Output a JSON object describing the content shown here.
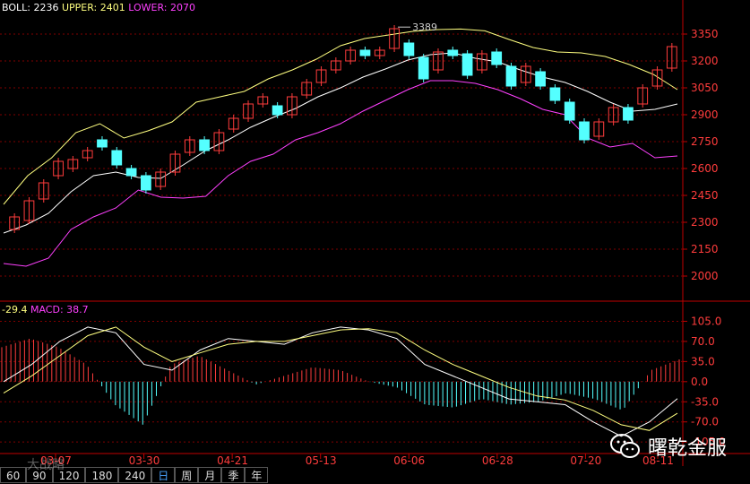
{
  "legend_top": {
    "boll_label": "BOLL:",
    "boll_value": "2236",
    "upper_label": "UPPER:",
    "upper_value": "2401",
    "lower_label": "LOWER:",
    "lower_value": "2070"
  },
  "legend_bottom": {
    "dif_value": "-29.4",
    "macd_label": "MACD:",
    "macd_value": "38.7"
  },
  "colors": {
    "up": "#ff3c3c",
    "down": "#54ffff",
    "mid": "#ffffff",
    "upper": "#ffff80",
    "lower": "#ff40ff",
    "grid": "#800000",
    "axis": "#c00000",
    "text": "#ff3c3c"
  },
  "periods": [
    "60",
    "90",
    "120",
    "180",
    "240",
    "日",
    "周",
    "月",
    "季",
    "年"
  ],
  "active_period": "日",
  "watermark_text": "曙乾金服",
  "faint_watermark": "大战略",
  "chart_data": [
    {
      "type": "candlestick",
      "title": "",
      "indicator": "BOLL",
      "y_ticks": [
        3350,
        3200,
        3050,
        2900,
        2750,
        2600,
        2450,
        2300,
        2150,
        2000
      ],
      "ylim": [
        1870,
        3450
      ],
      "x_ticks": [
        "03-07",
        "03-30",
        "04-21",
        "05-13",
        "06-06",
        "06-28",
        "07-20",
        "08-11"
      ],
      "annotation": {
        "label": "3389",
        "value": 3389
      },
      "series": [
        {
          "name": "BOLL",
          "values": [
            2240,
            2285,
            2350,
            2470,
            2560,
            2580,
            2550,
            2545,
            2620,
            2700,
            2760,
            2830,
            2885,
            2935,
            3000,
            3050,
            3110,
            3155,
            3205,
            3235,
            3245,
            3215,
            3195,
            3150,
            3110,
            3080,
            3030,
            2970,
            2920,
            2930,
            2960
          ]
        },
        {
          "name": "UPPER",
          "values": [
            2400,
            2560,
            2660,
            2800,
            2850,
            2770,
            2810,
            2860,
            2970,
            3000,
            3030,
            3100,
            3150,
            3210,
            3285,
            3325,
            3345,
            3365,
            3375,
            3378,
            3368,
            3320,
            3275,
            3250,
            3245,
            3225,
            3180,
            3125,
            3040
          ]
        },
        {
          "name": "LOWER",
          "values": [
            2070,
            2055,
            2100,
            2260,
            2330,
            2380,
            2480,
            2440,
            2435,
            2445,
            2560,
            2640,
            2680,
            2760,
            2800,
            2850,
            2920,
            2980,
            3040,
            3090,
            3090,
            3075,
            3040,
            2990,
            2930,
            2900,
            2770,
            2720,
            2740,
            2660,
            2670
          ]
        }
      ],
      "candles": [
        {
          "o": 2260,
          "c": 2330
        },
        {
          "o": 2310,
          "c": 2420
        },
        {
          "o": 2430,
          "c": 2520
        },
        {
          "o": 2560,
          "c": 2640
        },
        {
          "o": 2600,
          "c": 2650
        },
        {
          "o": 2660,
          "c": 2700
        },
        {
          "o": 2760,
          "c": 2720
        },
        {
          "o": 2700,
          "c": 2620
        },
        {
          "o": 2600,
          "c": 2560
        },
        {
          "o": 2560,
          "c": 2480
        },
        {
          "o": 2500,
          "c": 2580
        },
        {
          "o": 2580,
          "c": 2680
        },
        {
          "o": 2690,
          "c": 2760
        },
        {
          "o": 2760,
          "c": 2700
        },
        {
          "o": 2700,
          "c": 2800
        },
        {
          "o": 2820,
          "c": 2880
        },
        {
          "o": 2880,
          "c": 2960
        },
        {
          "o": 2960,
          "c": 3000
        },
        {
          "o": 2950,
          "c": 2900
        },
        {
          "o": 2900,
          "c": 3000
        },
        {
          "o": 3010,
          "c": 3080
        },
        {
          "o": 3080,
          "c": 3150
        },
        {
          "o": 3150,
          "c": 3200
        },
        {
          "o": 3200,
          "c": 3260
        },
        {
          "o": 3260,
          "c": 3230
        },
        {
          "o": 3230,
          "c": 3260
        },
        {
          "o": 3270,
          "c": 3380
        },
        {
          "o": 3300,
          "c": 3230
        },
        {
          "o": 3220,
          "c": 3100
        },
        {
          "o": 3150,
          "c": 3250
        },
        {
          "o": 3260,
          "c": 3230
        },
        {
          "o": 3240,
          "c": 3120
        },
        {
          "o": 3150,
          "c": 3240
        },
        {
          "o": 3250,
          "c": 3180
        },
        {
          "o": 3170,
          "c": 3060
        },
        {
          "o": 3080,
          "c": 3170
        },
        {
          "o": 3140,
          "c": 3060
        },
        {
          "o": 3050,
          "c": 2980
        },
        {
          "o": 2970,
          "c": 2870
        },
        {
          "o": 2860,
          "c": 2760
        },
        {
          "o": 2780,
          "c": 2860
        },
        {
          "o": 2860,
          "c": 2940
        },
        {
          "o": 2940,
          "c": 2870
        },
        {
          "o": 2960,
          "c": 3050
        },
        {
          "o": 3060,
          "c": 3150
        },
        {
          "o": 3160,
          "c": 3280
        }
      ]
    },
    {
      "type": "macd",
      "title": "",
      "y_ticks": [
        105.0,
        70.0,
        35.0,
        0.0,
        -35.0,
        -70.0,
        -105.0
      ],
      "ylim": [
        -125,
        140
      ],
      "series": [
        {
          "name": "DIF",
          "values": [
            0,
            30,
            70,
            95,
            85,
            30,
            20,
            55,
            75,
            70,
            65,
            85,
            95,
            90,
            75,
            30,
            10,
            -10,
            -30,
            -35,
            -40,
            -70,
            -95,
            -70,
            -29.4
          ]
        },
        {
          "name": "DEA",
          "values": [
            -20,
            10,
            45,
            80,
            95,
            60,
            35,
            50,
            65,
            70,
            70,
            80,
            90,
            92,
            85,
            55,
            30,
            10,
            -10,
            -25,
            -32,
            -50,
            -75,
            -85,
            -55
          ]
        },
        {
          "name": "MACD",
          "values": [
            60,
            75,
            60,
            30,
            -40,
            -75,
            30,
            45,
            20,
            -5,
            10,
            25,
            20,
            0,
            -10,
            -40,
            -45,
            -30,
            -40,
            -35,
            -20,
            -30,
            -50,
            20,
            38.7
          ]
        }
      ]
    }
  ]
}
